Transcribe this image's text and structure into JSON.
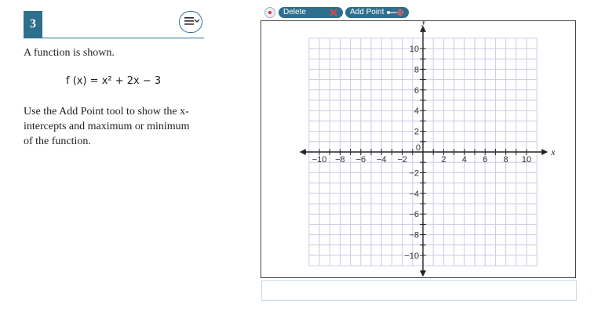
{
  "question": {
    "number": "3",
    "prompt": "A function is shown.",
    "formula": "f (x) = x² + 2x − 3",
    "instructions": "Use the Add Point tool to show the x-intercepts and maximum or minimum of the function."
  },
  "toolbar": {
    "delete_label": "Delete",
    "add_point_label": "Add Point"
  },
  "graph": {
    "x_axis_label": "x",
    "y_axis_label": "y",
    "x_min": -11,
    "x_max": 11,
    "y_min": -11,
    "y_max": 11,
    "x_tick_labels": [
      "−10",
      "−8",
      "−6",
      "−4",
      "−2",
      "0",
      "2",
      "4",
      "6",
      "8",
      "10"
    ],
    "y_tick_labels": [
      "10",
      "8",
      "6",
      "4",
      "2",
      "−2",
      "−4",
      "−6",
      "−8",
      "−10"
    ],
    "grid": true,
    "grid_color": "#c9cbe6",
    "axis_color": "#222222"
  },
  "colors": {
    "accent": "#2e6f8e",
    "answer_box_border": "#c9dbe6"
  },
  "icons": {
    "menu": "hamburger-chevron-icon",
    "close": "close-icon",
    "delete": "delete-x-icon",
    "add_point": "add-point-icon"
  }
}
